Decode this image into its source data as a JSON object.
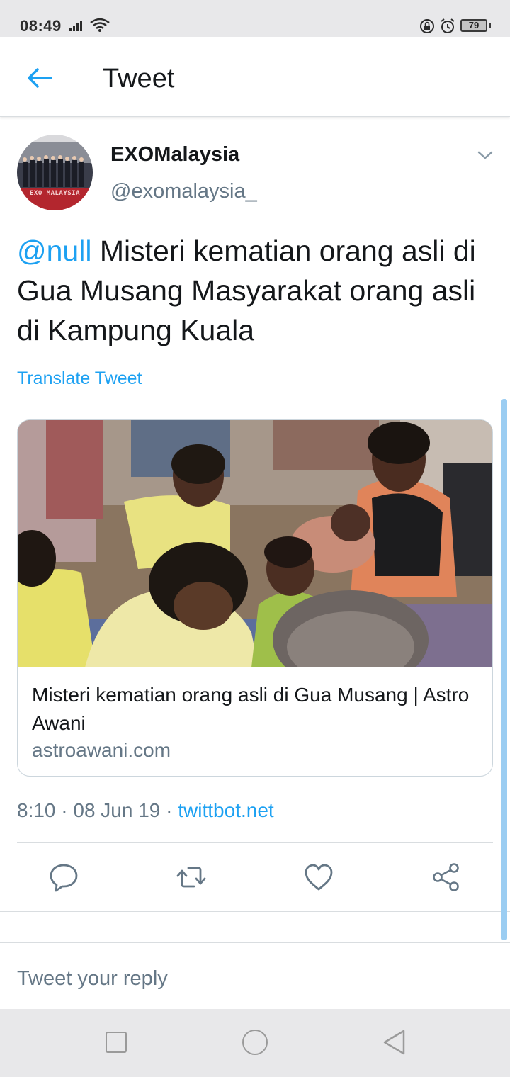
{
  "status_bar": {
    "time": "08:49",
    "battery": "79"
  },
  "header": {
    "title": "Tweet"
  },
  "tweet": {
    "display_name": "EXOMalaysia",
    "handle": "@exomalaysia_",
    "mention": "@null",
    "text": " Misteri kematian orang asli di Gua Musang Masyarakat orang asli di Kampung Kuala",
    "translate_label": "Translate Tweet",
    "avatar_caption": "EXO MALAYSIA",
    "card": {
      "title": "Misteri kematian orang asli di Gua Musang | Astro Awani",
      "domain": "astroawani.com"
    },
    "timestamp": "8:10 · 08 Jun 19 · ",
    "source": "twittbot.net"
  },
  "reply": {
    "placeholder": "Tweet your reply"
  },
  "colors": {
    "accent": "#1da1f2",
    "secondary_text": "#657786",
    "primary_text": "#14171a"
  },
  "icons": {
    "back": "arrow-left-icon",
    "caret": "chevron-down-icon",
    "reply": "reply-icon",
    "retweet": "retweet-icon",
    "like": "heart-icon",
    "share": "share-icon"
  }
}
